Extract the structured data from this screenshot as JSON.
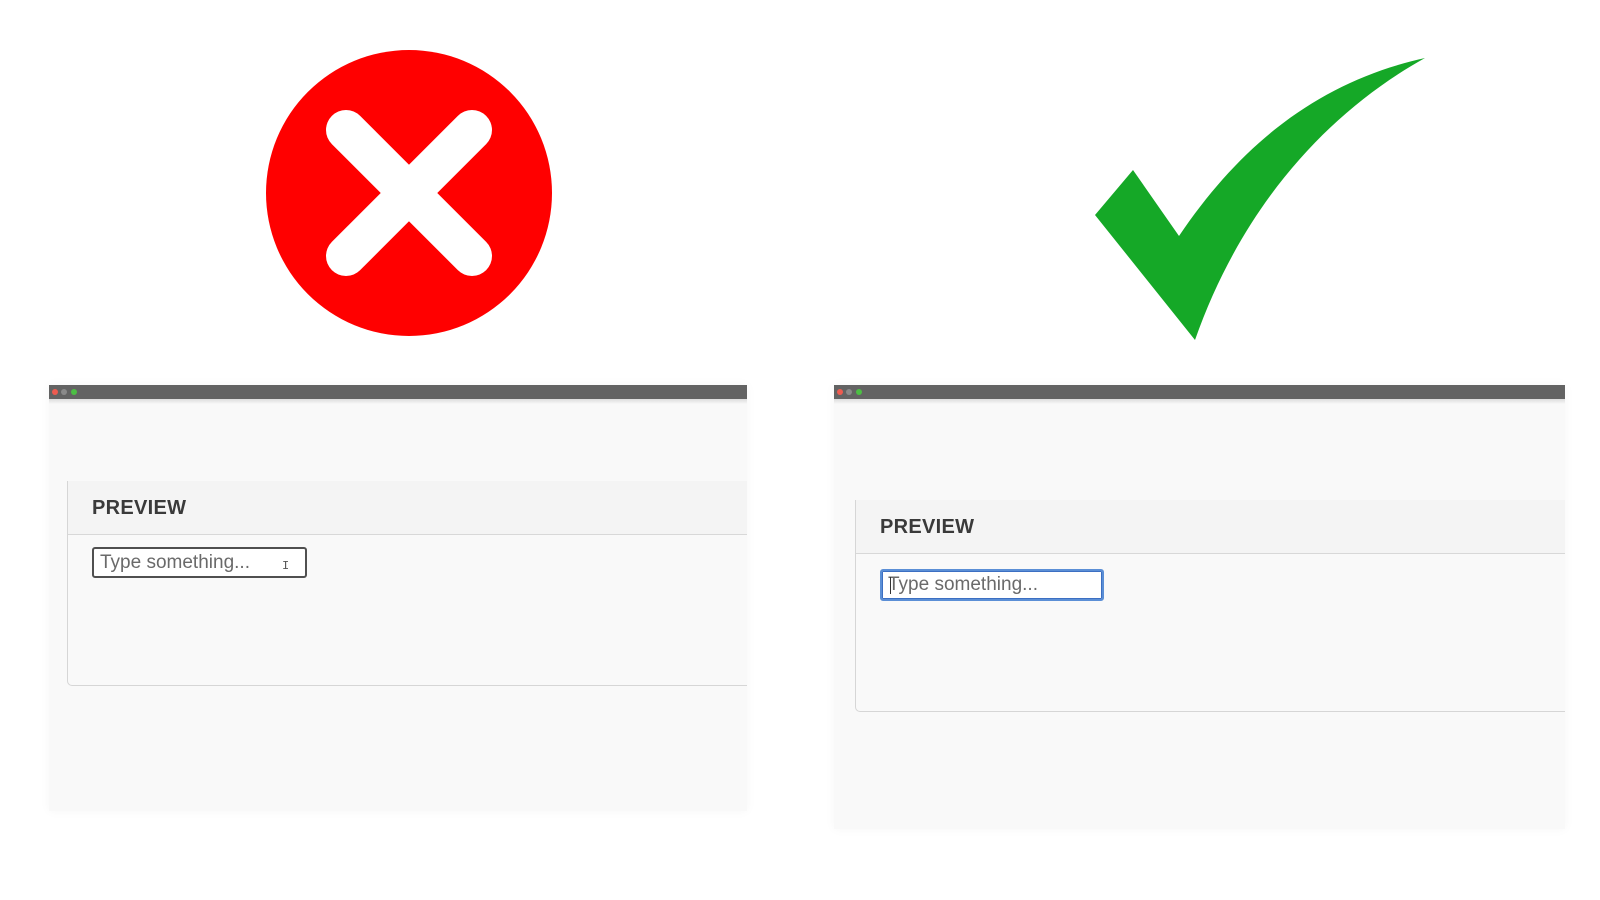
{
  "symbols": {
    "bad": {
      "icon": "x-mark-icon",
      "color": "#ff0000"
    },
    "good": {
      "icon": "checkmark-icon",
      "color": "#15a827"
    }
  },
  "examples": {
    "bad": {
      "panel_title": "PREVIEW",
      "input_placeholder": "Type something...",
      "focused": false
    },
    "good": {
      "panel_title": "PREVIEW",
      "input_placeholder": "Type something...",
      "focused": true
    }
  },
  "colors": {
    "titlebar": "#636363",
    "focus_ring": "#5b8fd6"
  }
}
